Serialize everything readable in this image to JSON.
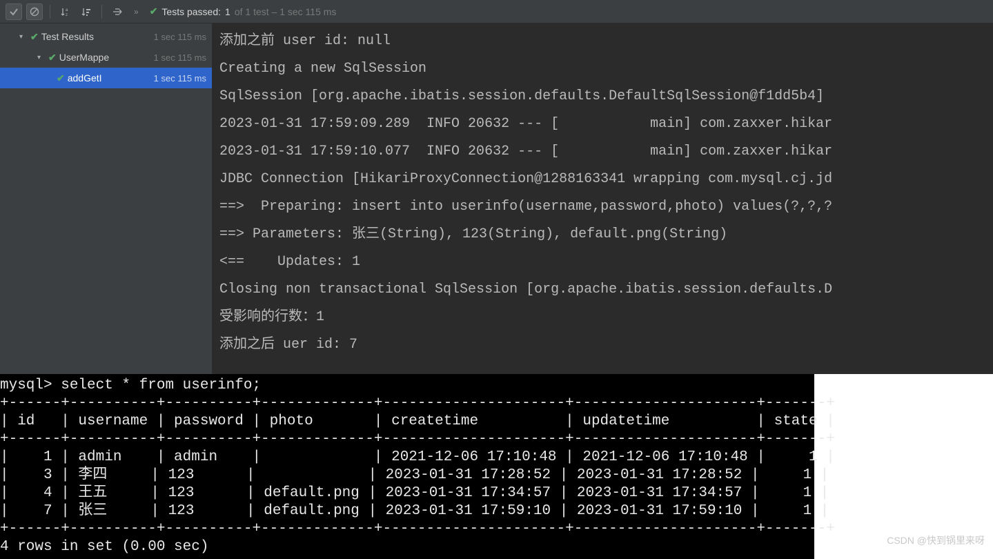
{
  "toolbar": {
    "status_prefix": "Tests passed:",
    "passed_count": "1",
    "of_text": "of 1 test – 1 sec 115 ms"
  },
  "tree": {
    "root": {
      "label": "Test Results",
      "time": "1 sec 115 ms"
    },
    "l1": {
      "label": "UserMappe",
      "time": "1 sec 115 ms"
    },
    "l2": {
      "label": "addGetI",
      "time": "1 sec 115 ms"
    }
  },
  "console_lines": [
    "添加之前 user id: null",
    "Creating a new SqlSession",
    "SqlSession [org.apache.ibatis.session.defaults.DefaultSqlSession@f1dd5b4]",
    "2023-01-31 17:59:09.289  INFO 20632 --- [           main] com.zaxxer.hikar",
    "2023-01-31 17:59:10.077  INFO 20632 --- [           main] com.zaxxer.hikar",
    "JDBC Connection [HikariProxyConnection@1288163341 wrapping com.mysql.cj.jd",
    "==>  Preparing: insert into userinfo(username,password,photo) values(?,?,?",
    "==> Parameters: 张三(String), 123(String), default.png(String)",
    "<==    Updates: 1",
    "Closing non transactional SqlSession [org.apache.ibatis.session.defaults.D",
    "受影响的行数：1",
    "添加之后 uer id: 7"
  ],
  "mysql": {
    "prompt": "mysql> select * from userinfo;",
    "border_top": "+------+----------+----------+-------------+---------------------+---------------------+-------+",
    "header": "| id   | username | password | photo       | createtime          | updatetime          | state |",
    "rows": [
      "|    1 | admin    | admin    |             | 2021-12-06 17:10:48 | 2021-12-06 17:10:48 |     1 |",
      "|    3 | 李四     | 123      |             | 2023-01-31 17:28:52 | 2023-01-31 17:28:52 |     1 |",
      "|    4 | 王五     | 123      | default.png | 2023-01-31 17:34:57 | 2023-01-31 17:34:57 |     1 |",
      "|    7 | 张三     | 123      | default.png | 2023-01-31 17:59:10 | 2023-01-31 17:59:10 |     1 |"
    ],
    "footer": "4 rows in set (0.00 sec)"
  },
  "watermark": "CSDN @快到锅里来呀"
}
